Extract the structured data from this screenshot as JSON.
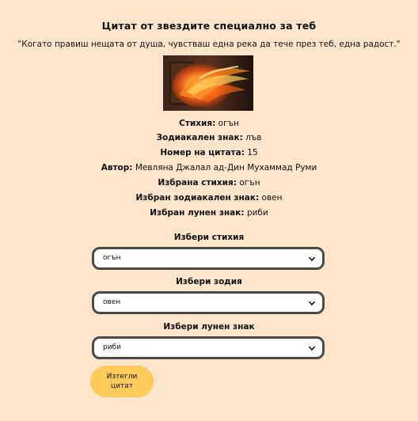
{
  "heading": "Цитат от звездите специално за теб",
  "quote": "\"Когато правиш нещата от душа, чувстваш една река да тече през теб, една радост.\"",
  "image": {
    "icon": "fire-image"
  },
  "info": {
    "element_label": "Стихия:",
    "element_value": "огън",
    "zodiac_label": "Зодиакален знак:",
    "zodiac_value": "лъв",
    "number_label": "Номер на цитата:",
    "number_value": "15",
    "author_label": "Автор:",
    "author_value": "Мевляна Джалал ад-Дин Мухаммад Руми",
    "chosen_element_label": "Избрана стихия:",
    "chosen_element_value": "огън",
    "chosen_zodiac_label": "Избран зодиакален знак:",
    "chosen_zodiac_value": "овен",
    "chosen_moon_label": "Избран лунен знак:",
    "chosen_moon_value": "риби"
  },
  "selects": {
    "element_label": "Избери стихия",
    "element_value": "огън",
    "zodiac_label": "Избери зодия",
    "zodiac_value": "овен",
    "moon_label": "Избери лунен знак",
    "moon_value": "риби"
  },
  "button": {
    "line1": "Изтегли",
    "line2": "цитат"
  },
  "colors": {
    "background": "#fde5cc",
    "button": "#fccb5c",
    "select_border": "#4a4a4a"
  }
}
